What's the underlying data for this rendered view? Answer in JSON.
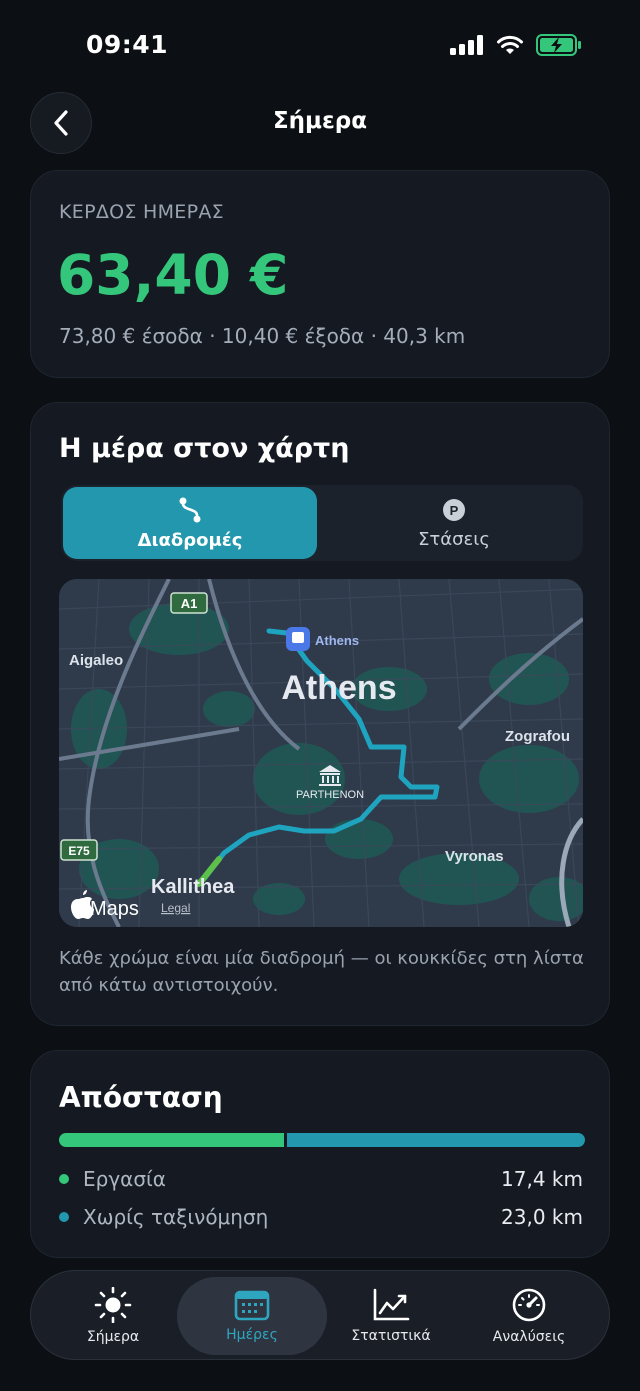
{
  "status_bar": {
    "time": "09:41"
  },
  "header": {
    "title": "Σήμερα"
  },
  "earnings": {
    "label": "ΚΕΡΔΟΣ ΗΜΕΡΑΣ",
    "amount": "63,40 €",
    "summary": "73,80 € έσοδα · 10,40 € έξοδα · 40,3 km"
  },
  "map_section": {
    "title": "Η μέρα στον χάρτη",
    "tabs": [
      {
        "label": "Διαδρομές",
        "icon": "route-icon",
        "selected": true
      },
      {
        "label": "Στάσεις",
        "icon": "parking-icon",
        "selected": false
      }
    ],
    "map": {
      "city": "Athens",
      "transit_label": "Athens",
      "landmark": "PARTHENON",
      "places": [
        "Aigaleo",
        "Zografou",
        "Vyronas",
        "Kallithea"
      ],
      "road_a1": "A1",
      "road_e75": "E75",
      "brand": "Maps",
      "legal": "Legal",
      "route_color": "#1fa4c0"
    },
    "caption": "Κάθε χρώμα είναι μία διαδρομή — οι κουκκίδες στη λίστα από κάτω αντιστοιχούν."
  },
  "distance": {
    "title": "Απόσταση",
    "items": [
      {
        "name": "Εργασία",
        "value": "17,4 km",
        "km": 17.4,
        "color": "#34c77b"
      },
      {
        "name": "Χωρίς ταξινόμηση",
        "value": "23,0 km",
        "km": 23.0,
        "color": "#2397ad"
      }
    ]
  },
  "tab_bar": {
    "items": [
      {
        "label": "Σήμερα",
        "icon": "sun-icon",
        "active": false
      },
      {
        "label": "Ημέρες",
        "icon": "calendar-icon",
        "active": true
      },
      {
        "label": "Στατιστικά",
        "icon": "chart-icon",
        "active": false
      },
      {
        "label": "Αναλύσεις",
        "icon": "gauge-icon",
        "active": false
      }
    ]
  }
}
